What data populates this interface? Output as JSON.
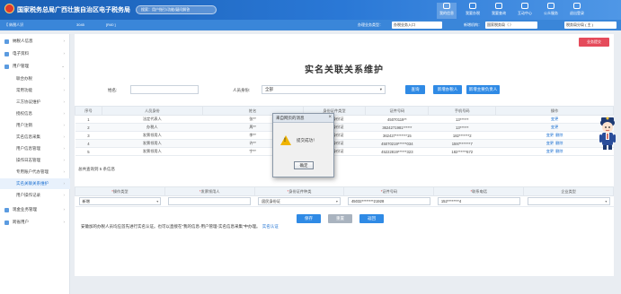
{
  "header": {
    "brand": "国家税务总局广西壮族自治区电子税务局",
    "search_placeholder": "搜索：用户指引/功能/疑问解答",
    "nav": [
      {
        "label": "我的信息",
        "icon": "user-icon"
      },
      {
        "label": "我要办税",
        "icon": "tax-icon"
      },
      {
        "label": "我要查询",
        "icon": "query-icon"
      },
      {
        "label": "互动中心",
        "icon": "chat-icon"
      },
      {
        "label": "公众服务",
        "icon": "service-icon"
      },
      {
        "label": "退出登录",
        "icon": "logout-icon"
      }
    ]
  },
  "subbar": {
    "company_prefix": "【 纳税人识",
    "company_mid": "3045",
    "company_suffix": "[R40 ]",
    "agency_label": "办理业务类型：",
    "agency_value": "办税业务入口",
    "switch_label": "新增机构：",
    "switch_value": "国家税务局（ ）",
    "role_value": "税务局分局 ( 主 )"
  },
  "sidebar": {
    "items": [
      {
        "label": "纳税人信息",
        "icon": "info-icon",
        "chevron": "›"
      },
      {
        "label": "电子资料",
        "icon": "file-icon",
        "chevron": "›"
      },
      {
        "label": "用户管理",
        "icon": "users-icon",
        "chevron": "⌄"
      }
    ],
    "subitems": [
      {
        "label": "联合办税",
        "chevron": "›"
      },
      {
        "label": "常用功能",
        "chevron": "›"
      },
      {
        "label": "三方协议维护",
        "chevron": "›"
      },
      {
        "label": "授权信息",
        "chevron": "›"
      },
      {
        "label": "用户注销",
        "chevron": "›"
      },
      {
        "label": "实名信息采集",
        "chevron": "›"
      },
      {
        "label": "用户信息管理",
        "chevron": "›"
      },
      {
        "label": "操作日志管理",
        "chevron": "›"
      },
      {
        "label": "专用账户代办管理",
        "chevron": "›"
      },
      {
        "label": "实名关联关系维护",
        "chevron": "›"
      },
      {
        "label": "用户操作记录",
        "chevron": "›"
      }
    ],
    "bottom_items": [
      {
        "label": "现金业务管理",
        "icon": "cash-icon",
        "chevron": "›"
      },
      {
        "label": "跨省用户",
        "icon": "map-icon",
        "chevron": "›"
      }
    ]
  },
  "main": {
    "top_button": "业务提交",
    "title": "实名关联关系维护",
    "search": {
      "name_label": "姓名:",
      "identity_label": "人员身份:",
      "identity_value": "全部",
      "query_button": "查询",
      "add_button": "新增办税人",
      "batch_button": "新增主要负责人"
    },
    "table": {
      "columns": [
        "序号",
        "人员身份",
        "姓名",
        "身份证件类型",
        "证件号码",
        "手机号码",
        "操作"
      ],
      "rows": [
        {
          "no": "1",
          "role": "法定代表人",
          "name": "张**",
          "id_type": "居民身份证",
          "id_no": "45070119**",
          "phone": "13******",
          "actions": [
            "变更"
          ]
        },
        {
          "no": "2",
          "role": "办税人",
          "name": "周**",
          "id_type": "居民身份证",
          "id_no": "3624271981******",
          "phone": "13******",
          "actions": [
            "变更"
          ]
        },
        {
          "no": "3",
          "role": "发票领用人",
          "name": "李**",
          "id_type": "居民身份证",
          "id_no": "362427********15",
          "phone": "182*******2",
          "actions": [
            "变更",
            "删除"
          ]
        },
        {
          "no": "4",
          "role": "发票领用人",
          "name": "许**",
          "id_type": "居民身份证",
          "id_no": "45070219******034",
          "phone": "1597*******7",
          "actions": [
            "变更",
            "删除"
          ]
        },
        {
          "no": "5",
          "role": "发票领用人",
          "name": "宁**",
          "id_type": "居民身份证",
          "id_no": "45222819******323",
          "phone": "182******672",
          "actions": [
            "变更",
            "删除"
          ]
        }
      ],
      "total": "总共查询到 5 条信息"
    },
    "form": {
      "columns": [
        {
          "label": "操作类型",
          "required": true
        },
        {
          "label": "发票领用人",
          "required": true
        },
        {
          "label": "身份证件种类",
          "required": true
        },
        {
          "label": "证件号码",
          "required": true
        },
        {
          "label": "联系电话",
          "required": true
        },
        {
          "label": "企业类型",
          "required": false
        }
      ],
      "values": [
        "新增",
        "",
        "居民身份证",
        "45032********21928",
        "152********4",
        ""
      ],
      "submit_button": "保存",
      "reset_button": "重置",
      "back_button": "返回"
    },
    "notice": {
      "text": "安徽加的办税人员均应首先进行实名认证。也可以直接在“我的信息-用户管理-实名信息采集”中办理。",
      "link": "实名认证"
    }
  },
  "dialog": {
    "title": "来自网页的消息",
    "message": "提交成功！",
    "ok_label": "确定"
  },
  "colors": {
    "header_blue": "#1a5fb4",
    "accent_blue": "#2f8ae5",
    "pink_button": "#e54b5b",
    "warning_yellow": "#f0b400"
  }
}
